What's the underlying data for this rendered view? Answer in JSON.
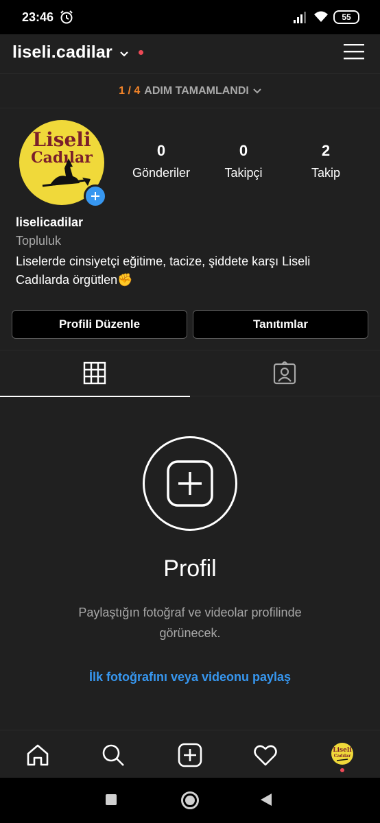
{
  "status_bar": {
    "time": "23:46",
    "battery": "55",
    "icons": [
      "alarm-icon",
      "signal-icon",
      "wifi-icon",
      "battery-icon"
    ]
  },
  "header": {
    "username": "liseli.cadilar",
    "icons": [
      "chevron-down-icon",
      "notification-dot",
      "menu-icon"
    ]
  },
  "steps": {
    "count": "1 / 4",
    "label": "ADIM TAMAMLANDI"
  },
  "profile": {
    "avatar_text_line1": "Liseli",
    "avatar_text_line2": "Cadılar",
    "stats": [
      {
        "value": "0",
        "label": "Gönderiler"
      },
      {
        "value": "0",
        "label": "Takipçi"
      },
      {
        "value": "2",
        "label": "Takip"
      }
    ],
    "name": "liselicadilar",
    "category": "Topluluk",
    "bio": "Liselerde cinsiyetçi eğitime, tacize, şiddete karşı Liseli Cadılarda örgütlen✊"
  },
  "buttons": {
    "edit_profile": "Profili Düzenle",
    "promotions": "Tanıtımlar"
  },
  "tabs": [
    "grid-icon",
    "tagged-icon"
  ],
  "empty_state": {
    "title": "Profil",
    "description": "Paylaştığın fotoğraf ve videolar profilinde görünecek.",
    "link": "İlk fotoğrafını veya videonu paylaş"
  },
  "bottom_nav": [
    "home-icon",
    "search-icon",
    "add-post-icon",
    "heart-icon",
    "profile-avatar"
  ],
  "colors": {
    "background": "#202020",
    "accent_blue": "#3797f0",
    "steps_orange": "#f58529",
    "notification_red": "#ed4956",
    "avatar_yellow": "#f0d93a",
    "avatar_text": "#7a1f2b"
  }
}
